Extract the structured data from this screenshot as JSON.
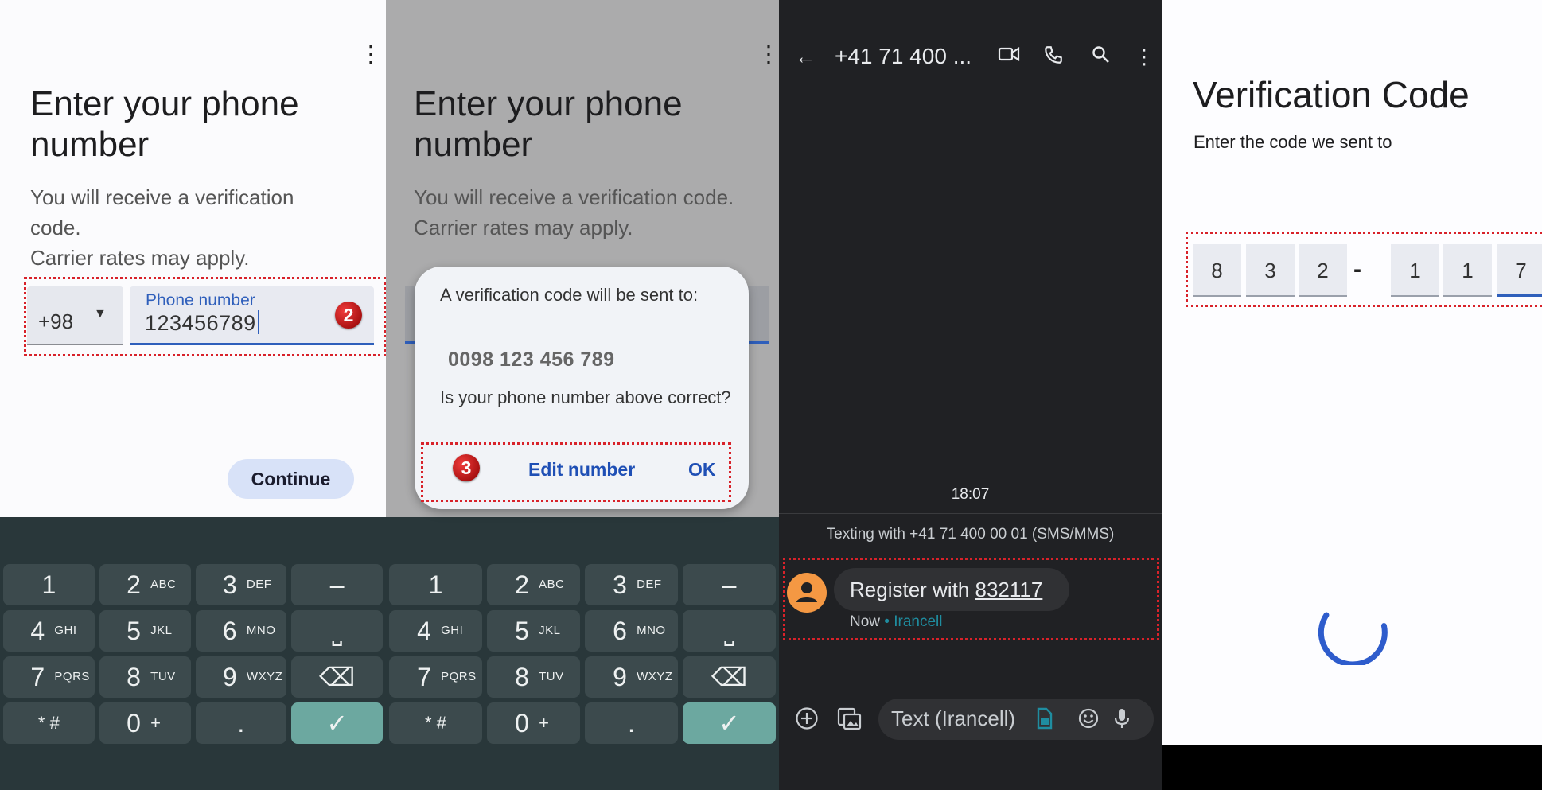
{
  "phone_entry": {
    "title": "Enter your phone number",
    "subtitle_line1": "You will receive a verification code.",
    "subtitle_line2": "Carrier rates may apply.",
    "country_code": "+98",
    "field_label": "Phone number",
    "field_value": "123456789",
    "badge": "2",
    "continue_label": "Continue"
  },
  "confirm_dialog": {
    "title": "Enter your phone number",
    "subtitle_line1": "You will receive a verification code.",
    "subtitle_line2": "Carrier rates may apply.",
    "message": "A verification code will be sent to:",
    "number": "0098 123 456 789",
    "question": "Is your phone number above correct?",
    "badge": "3",
    "edit_label": "Edit number",
    "ok_label": "OK"
  },
  "keyboard": {
    "keys": [
      {
        "digit": "1",
        "letters": ""
      },
      {
        "digit": "2",
        "letters": "ABC"
      },
      {
        "digit": "3",
        "letters": "DEF"
      },
      {
        "digit": "–",
        "letters": ""
      },
      {
        "digit": "4",
        "letters": "GHI"
      },
      {
        "digit": "5",
        "letters": "JKL"
      },
      {
        "digit": "6",
        "letters": "MNO"
      },
      {
        "digit": "⎵",
        "letters": ""
      },
      {
        "digit": "7",
        "letters": "PQRS"
      },
      {
        "digit": "8",
        "letters": "TUV"
      },
      {
        "digit": "9",
        "letters": "WXYZ"
      },
      {
        "digit": "⌫",
        "letters": ""
      },
      {
        "digit": "* #",
        "letters": ""
      },
      {
        "digit": "0",
        "letters": "+"
      },
      {
        "digit": ".",
        "letters": ""
      },
      {
        "digit": "✓",
        "letters": ""
      }
    ]
  },
  "messages": {
    "contact": "+41 71 400 ...",
    "time": "18:07",
    "texting_with": "Texting with +41 71 400 00 01 (SMS/MMS)",
    "message_prefix": "Register with ",
    "message_code": "832117",
    "meta_time": "Now",
    "meta_carrier": "• Irancell",
    "compose_placeholder": "Text (Irancell)",
    "icons": [
      "back-arrow-icon",
      "video-call-icon",
      "phone-icon",
      "search-icon",
      "more-vert-icon",
      "add-icon",
      "gallery-icon",
      "sim-icon",
      "emoji-icon",
      "mic-icon"
    ]
  },
  "verification": {
    "title": "Verification Code",
    "subtitle": "Enter the code we sent to",
    "digits": [
      "8",
      "3",
      "2",
      "1",
      "1",
      "7"
    ],
    "separator": "-"
  },
  "colors": {
    "accent_blue": "#2f5fbb",
    "annotation_red": "#d8222a",
    "keyboard_bg": "#29373a",
    "key_bg": "#3c4a4d",
    "ok_key": "#6ca8a0",
    "avatar_orange": "#f49843",
    "chat_bg": "#202124"
  }
}
